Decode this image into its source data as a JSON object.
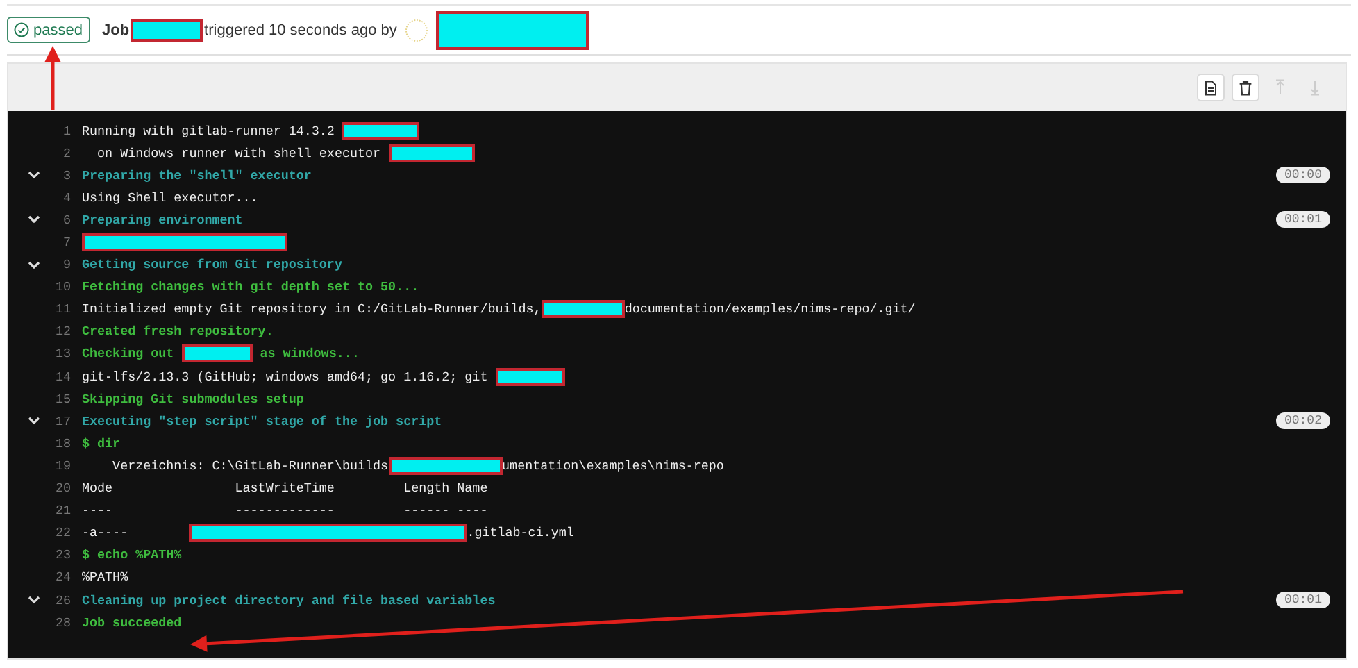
{
  "header": {
    "status": {
      "label": "passed",
      "kind": "success"
    },
    "job_label": "Job",
    "triggered": "triggered 10 seconds ago by"
  },
  "toolbar": [
    {
      "kind": "raw",
      "disabled": false
    },
    {
      "kind": "erase",
      "disabled": false
    },
    {
      "kind": "top",
      "disabled": true
    },
    {
      "kind": "bottom",
      "disabled": true
    }
  ],
  "log": [
    {
      "number": "1",
      "kind": "plain",
      "segments": [
        {
          "text": "Running with gitlab-runner 14.3.2 "
        },
        {
          "kind": "redacted"
        }
      ]
    },
    {
      "number": "2",
      "kind": "plain",
      "segments": [
        {
          "text": "  on Windows runner with shell executor "
        },
        {
          "kind": "redacted"
        }
      ]
    },
    {
      "number": "3",
      "kind": "section",
      "expanded": true,
      "duration": "00:00",
      "segments": [
        {
          "text": "Preparing the \"shell\" executor"
        }
      ]
    },
    {
      "number": "4",
      "kind": "plain",
      "segments": [
        {
          "text": "Using Shell executor..."
        }
      ]
    },
    {
      "number": "6",
      "kind": "section",
      "expanded": true,
      "duration": "00:01",
      "segments": [
        {
          "text": "Preparing environment"
        }
      ]
    },
    {
      "number": "7",
      "kind": "plain",
      "segments": [
        {
          "kind": "redacted"
        }
      ]
    },
    {
      "number": "9",
      "kind": "section",
      "expanded": true,
      "segments": [
        {
          "text": "Getting source from Git repository"
        }
      ]
    },
    {
      "number": "10",
      "kind": "success",
      "segments": [
        {
          "text": "Fetching changes with git depth set to 50..."
        }
      ]
    },
    {
      "number": "11",
      "kind": "plain",
      "segments": [
        {
          "text": "Initialized empty Git repository in C:/GitLab-Runner/builds,"
        },
        {
          "kind": "redacted"
        },
        {
          "text": "documentation/examples/nims-repo/.git/"
        }
      ]
    },
    {
      "number": "12",
      "kind": "success",
      "segments": [
        {
          "text": "Created fresh repository."
        }
      ]
    },
    {
      "number": "13",
      "kind": "success",
      "segments": [
        {
          "text": "Checking out "
        },
        {
          "kind": "redacted"
        },
        {
          "text": " as windows..."
        }
      ]
    },
    {
      "number": "14",
      "kind": "plain",
      "segments": [
        {
          "text": "git-lfs/2.13.3 (GitHub; windows amd64; go 1.16.2; git "
        },
        {
          "kind": "redacted"
        }
      ]
    },
    {
      "number": "15",
      "kind": "success",
      "segments": [
        {
          "text": "Skipping Git submodules setup"
        }
      ]
    },
    {
      "number": "17",
      "kind": "section",
      "expanded": true,
      "duration": "00:02",
      "segments": [
        {
          "text": "Executing \"step_script\" stage of the job script"
        }
      ]
    },
    {
      "number": "18",
      "kind": "success",
      "segments": [
        {
          "text": "$ dir"
        }
      ]
    },
    {
      "number": "19",
      "kind": "plain",
      "segments": [
        {
          "text": "    Verzeichnis: C:\\GitLab-Runner\\builds"
        },
        {
          "kind": "redacted"
        },
        {
          "text": "umentation\\examples\\nims-repo"
        }
      ]
    },
    {
      "number": "20",
      "kind": "plain",
      "segments": [
        {
          "text": "Mode                LastWriteTime         Length Name"
        }
      ]
    },
    {
      "number": "21",
      "kind": "plain",
      "segments": [
        {
          "text": "----                -------------         ------ ----"
        }
      ]
    },
    {
      "number": "22",
      "kind": "plain",
      "segments": [
        {
          "text": "-a----        "
        },
        {
          "kind": "redacted"
        },
        {
          "text": ".gitlab-ci.yml"
        }
      ]
    },
    {
      "number": "23",
      "kind": "success",
      "segments": [
        {
          "text": "$ echo %PATH%"
        }
      ]
    },
    {
      "number": "24",
      "kind": "plain",
      "segments": [
        {
          "text": "%PATH%"
        }
      ]
    },
    {
      "number": "26",
      "kind": "section",
      "expanded": true,
      "duration": "00:01",
      "segments": [
        {
          "text": "Cleaning up project directory and file based variables"
        }
      ]
    },
    {
      "number": "28",
      "kind": "success",
      "segments": [
        {
          "text": "Job succeeded"
        }
      ]
    }
  ],
  "annotations": [
    {
      "kind": "arrow"
    },
    {
      "kind": "arrow"
    }
  ]
}
